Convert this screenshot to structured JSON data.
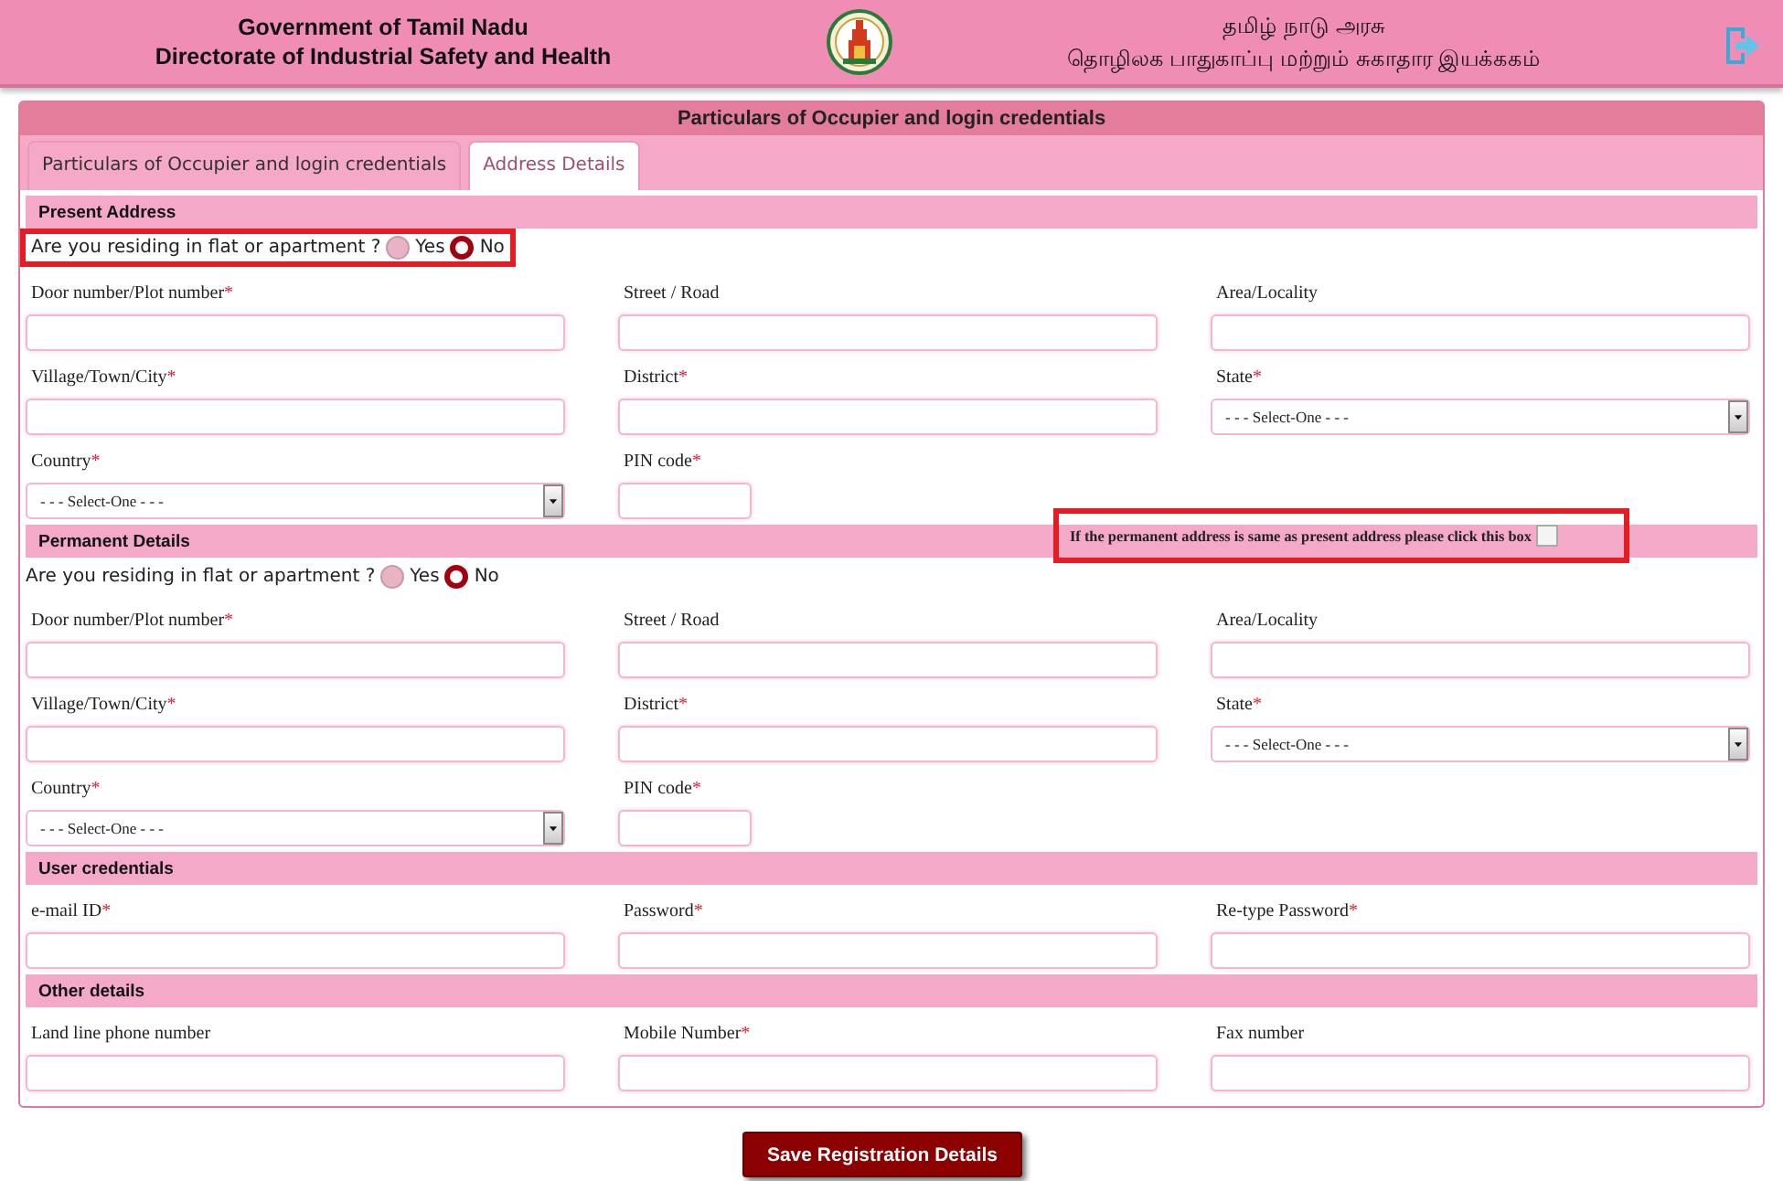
{
  "header": {
    "title_lines": [
      "Government of Tamil Nadu",
      "Directorate of Industrial Safety and Health"
    ],
    "tamil_lines": [
      "தமிழ் நாடு அரசு",
      "தொழிலக பாதுகாப்பு மற்றும் சுகாதார இயக்ககம்"
    ]
  },
  "panel": {
    "title": "Particulars of Occupier and login credentials"
  },
  "tabs": [
    {
      "label": "Particulars of Occupier and login credentials",
      "selected": false
    },
    {
      "label": "Address Details",
      "selected": true
    }
  ],
  "sections": [
    {
      "heading": "Present Address",
      "radio_question": {
        "text": "Are you residing in flat or apartment ?",
        "highlighted": true,
        "options": [
          {
            "label": "Yes",
            "selected": false
          },
          {
            "label": "No",
            "selected": true
          }
        ]
      },
      "fields": [
        {
          "label": "Door number/Plot number",
          "required_mark": "*",
          "kind": "text"
        },
        {
          "label": "Street / Road",
          "kind": "text"
        },
        {
          "label": "Area/Locality",
          "kind": "text"
        },
        {
          "label": "Village/Town/City",
          "required_mark": "*",
          "kind": "text"
        },
        {
          "label": "District",
          "required_mark": "*",
          "kind": "text"
        },
        {
          "label": "State",
          "required_mark": "*",
          "kind": "select",
          "value": "- - - Select-One - - -"
        },
        {
          "label": "Country",
          "required_mark": "*",
          "kind": "select",
          "value": "- - - Select-One - - -"
        },
        {
          "label": "PIN code",
          "required_mark": "*",
          "kind": "short"
        }
      ]
    },
    {
      "heading": "Permanent Details",
      "same_as_present": {
        "text": "If the permanent address is same as present address please click this box",
        "checked": false,
        "highlighted": true
      },
      "radio_question": {
        "text": "Are you residing in flat or apartment ?",
        "options": [
          {
            "label": "Yes",
            "selected": false
          },
          {
            "label": "No",
            "selected": true
          }
        ]
      },
      "fields": [
        {
          "label": "Door number/Plot number",
          "required_mark": "*",
          "kind": "text"
        },
        {
          "label": "Street / Road",
          "kind": "text"
        },
        {
          "label": "Area/Locality",
          "kind": "text"
        },
        {
          "label": "Village/Town/City",
          "required_mark": "*",
          "kind": "text"
        },
        {
          "label": "District",
          "required_mark": "*",
          "kind": "text"
        },
        {
          "label": "State",
          "required_mark": "*",
          "kind": "select",
          "value": "- - - Select-One - - -"
        },
        {
          "label": "Country",
          "required_mark": "*",
          "kind": "select",
          "value": "- - - Select-One - - -"
        },
        {
          "label": "PIN code",
          "required_mark": "*",
          "kind": "short"
        }
      ]
    },
    {
      "heading": "User credentials",
      "fields": [
        {
          "label": "e-mail ID",
          "required_mark": "*",
          "kind": "text"
        },
        {
          "label": "Password",
          "required_mark": "*",
          "kind": "text"
        },
        {
          "label": "Re-type Password",
          "required_mark": "*",
          "kind": "text"
        }
      ]
    },
    {
      "heading": "Other details",
      "fields": [
        {
          "label": "Land line phone number",
          "kind": "text"
        },
        {
          "label": "Mobile Number",
          "required_mark": "*",
          "kind": "text"
        },
        {
          "label": "Fax number",
          "kind": "text"
        }
      ]
    }
  ],
  "save_button": "Save Registration Details"
}
